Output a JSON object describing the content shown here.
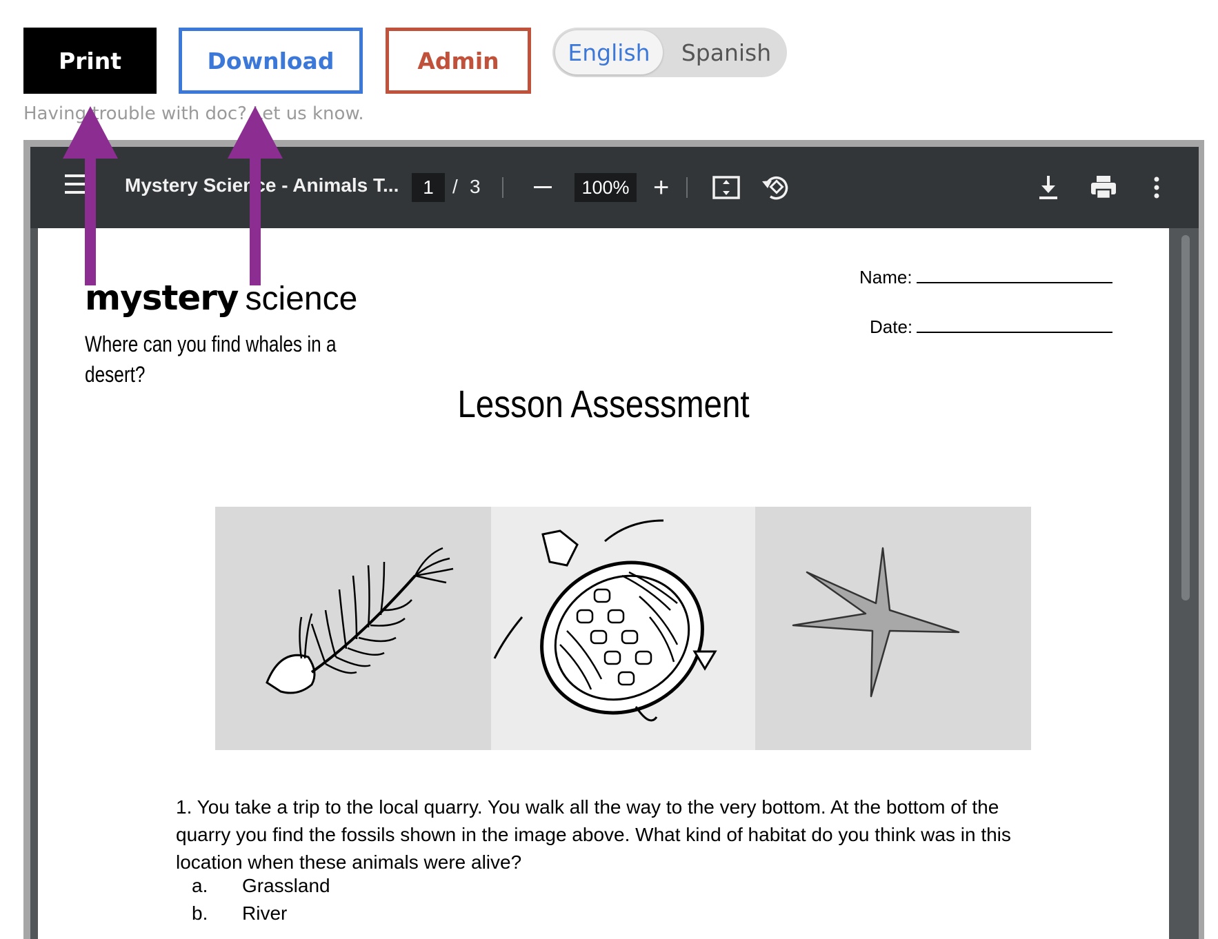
{
  "actions": {
    "print_label": "Print",
    "download_label": "Download",
    "admin_label": "Admin"
  },
  "language": {
    "options": [
      "English",
      "Spanish"
    ],
    "selected": "English"
  },
  "help_text": "Having trouble with doc? Let us know.",
  "viewer": {
    "title": "Mystery Science - Animals T...",
    "current_page": "1",
    "page_separator": "/",
    "total_pages": "3",
    "zoom": "100%",
    "icons": [
      "menu-icon",
      "zoom-out-icon",
      "zoom-in-icon",
      "fit-page-icon",
      "rotate-icon",
      "download-icon",
      "print-icon",
      "more-icon"
    ]
  },
  "document": {
    "logo_bold": "mystery",
    "logo_light": "science",
    "subtitle": "Where can you find whales in a desert?",
    "name_label": "Name:",
    "date_label": "Date:",
    "heading": "Lesson Assessment",
    "question": "1. You take a trip to the local quarry. You walk all the way to the very bottom. At the bottom of the quarry you find the fossils shown in the image above. What kind of habitat do you think was in this location when these animals were alive?",
    "options": [
      {
        "letter": "a.",
        "text": "Grassland"
      },
      {
        "letter": "b.",
        "text": "River"
      }
    ]
  },
  "colors": {
    "print_bg": "#000000",
    "download_accent": "#3c78d8",
    "admin_accent": "#c0513a",
    "toolbar_bg": "#323639",
    "annotation_arrow": "#8b2d91"
  }
}
